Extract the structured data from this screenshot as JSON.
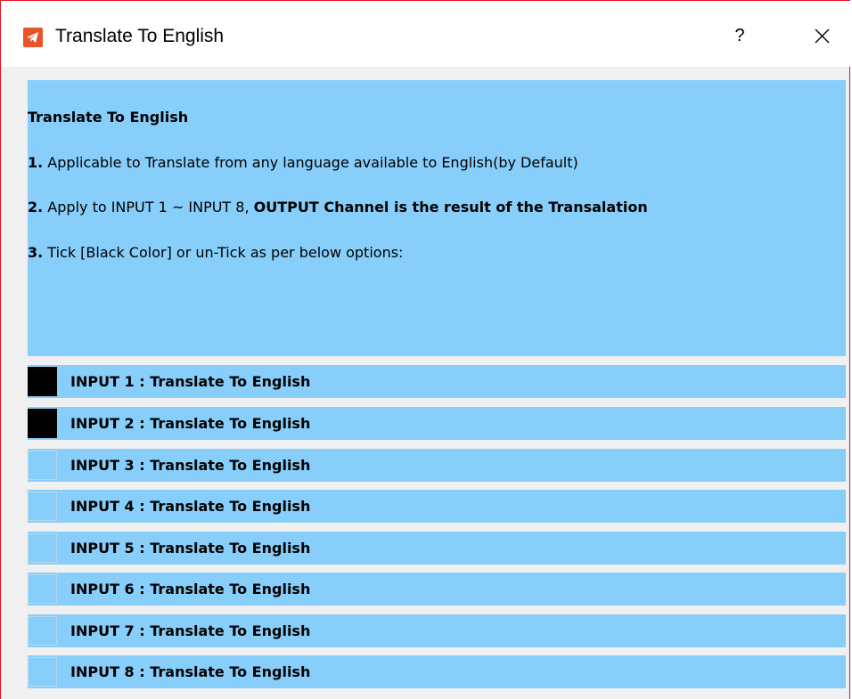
{
  "window": {
    "title": "Translate To English",
    "help_label": "?",
    "app_icon": "telegram-plane-icon",
    "close_icon": "close-icon",
    "border_color": "#e81123"
  },
  "info": {
    "heading": "Translate To English",
    "line1": {
      "num": "1.",
      "text": " Applicable to Translate from any language available to English(by Default)"
    },
    "line2": {
      "num": "2.",
      "text": " Apply to INPUT 1 ~ INPUT 8, ",
      "bold_text": "OUTPUT Channel is the result of the Transalation"
    },
    "line3": {
      "num": "3.",
      "text": " Tick [Black Color] or un-Tick as per below options:"
    },
    "panel_color": "#87cefa"
  },
  "inputs": [
    {
      "label": "INPUT 1 : Translate To English",
      "checked": true
    },
    {
      "label": "INPUT 2 : Translate To English",
      "checked": true
    },
    {
      "label": "INPUT 3 : Translate To English",
      "checked": false
    },
    {
      "label": "INPUT 4 : Translate To English",
      "checked": false
    },
    {
      "label": "INPUT 5 : Translate To English",
      "checked": false
    },
    {
      "label": "INPUT 6 : Translate To English",
      "checked": false
    },
    {
      "label": "INPUT 7 : Translate To English",
      "checked": false
    },
    {
      "label": "INPUT 8 : Translate To English",
      "checked": false
    }
  ]
}
